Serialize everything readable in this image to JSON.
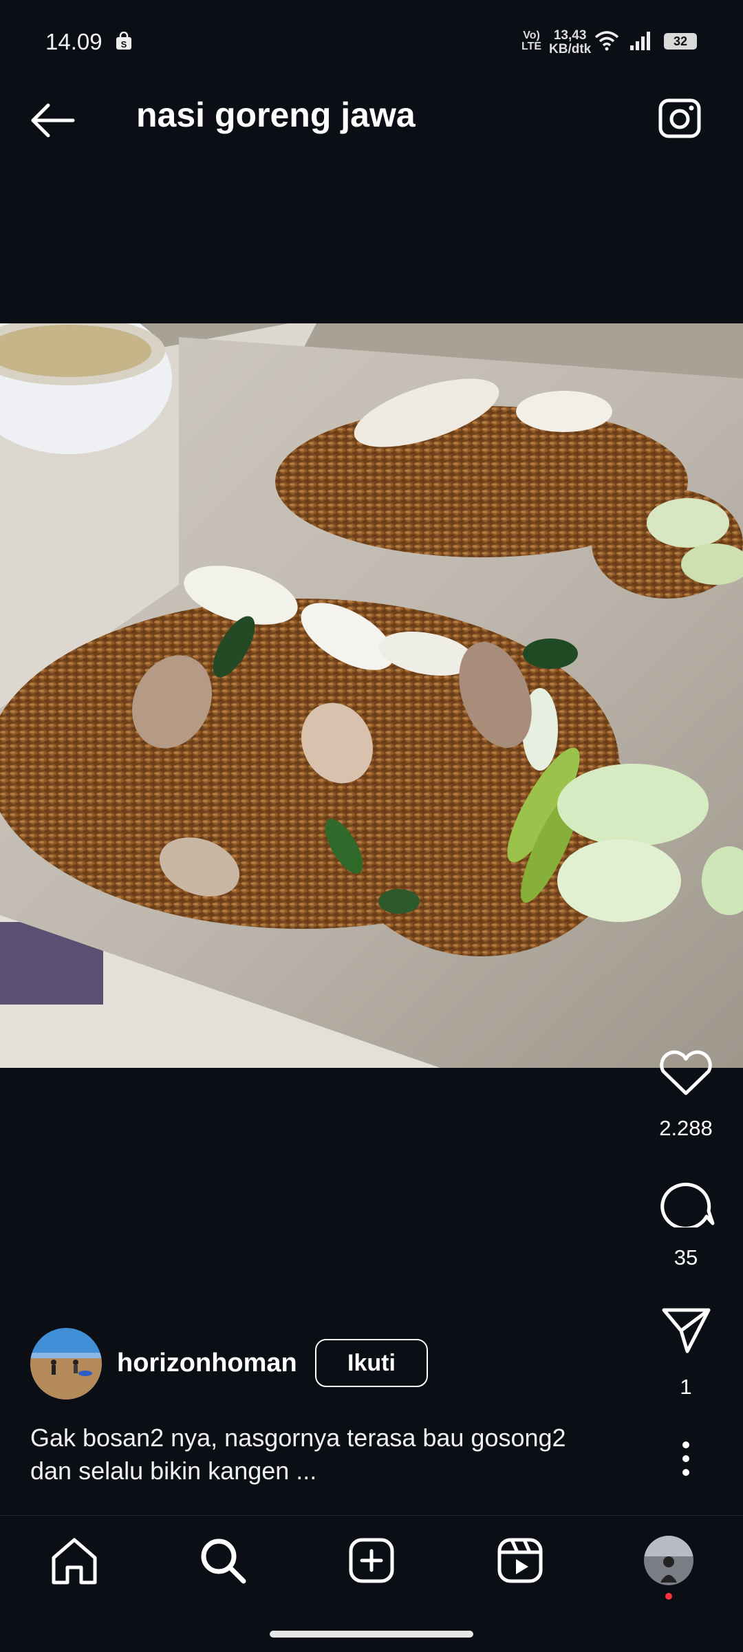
{
  "status_bar": {
    "time": "14.09",
    "network_top": "Vo)",
    "network_bottom": "LTE",
    "speed_top": "13,43",
    "speed_bottom": "KB/dtk",
    "battery": "32"
  },
  "header": {
    "title": "nasi goreng jawa"
  },
  "post": {
    "likes": "2.288",
    "comments": "35",
    "shares": "1",
    "author": "horizonhoman",
    "follow_label": "Ikuti",
    "caption_line1": "Gak bosan2 nya, nasgornya terasa bau gosong2",
    "caption_line2": "dan selalu bikin kangen ..."
  },
  "nav": {
    "items": [
      "home-icon",
      "search-icon",
      "create-icon",
      "reels-icon",
      "profile-avatar"
    ],
    "notification_color": "#ff3040"
  },
  "colors": {
    "background": "#0b0e14",
    "text": "#ffffff"
  }
}
